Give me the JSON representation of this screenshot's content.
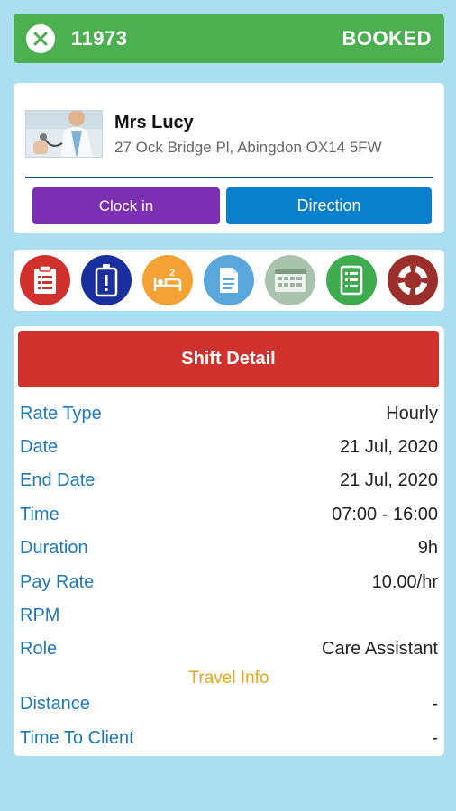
{
  "header": {
    "job_id": "11973",
    "status": "BOOKED",
    "bg_color": "#4caf50"
  },
  "client": {
    "name": "Mrs Lucy",
    "address": "27 Ock Bridge Pl, Abingdon OX14 5FW",
    "clock_in_label": "Clock in",
    "direction_label": "Direction"
  },
  "action_icons": [
    {
      "icon": "clipboard-list-icon",
      "color": "#d0312d"
    },
    {
      "icon": "badge-alert-icon",
      "color": "#1a2f9e"
    },
    {
      "icon": "bed-icon",
      "color": "#f4a235"
    },
    {
      "icon": "document-icon",
      "color": "#5aa7dc"
    },
    {
      "icon": "calendar-grid-icon",
      "color": "#a9c3ad"
    },
    {
      "icon": "checklist-icon",
      "color": "#3eab4e"
    },
    {
      "icon": "lifebuoy-icon",
      "color": "#9a2f2b"
    }
  ],
  "shift": {
    "title": "Shift Detail",
    "rows": [
      {
        "label": "Rate Type",
        "value": "Hourly"
      },
      {
        "label": "Date",
        "value": "21 Jul, 2020"
      },
      {
        "label": "End Date",
        "value": "21 Jul, 2020"
      },
      {
        "label": "Time",
        "value": "07:00 - 16:00"
      },
      {
        "label": "Duration",
        "value": "9h"
      },
      {
        "label": "Pay Rate",
        "value": "10.00/hr"
      },
      {
        "label": "RPM",
        "value": ""
      },
      {
        "label": "Role",
        "value": "Care Assistant"
      }
    ],
    "travel_title": "Travel Info",
    "travel_rows": [
      {
        "label": "Distance",
        "value": "-"
      },
      {
        "label": "Time To Client",
        "value": "-"
      }
    ]
  }
}
